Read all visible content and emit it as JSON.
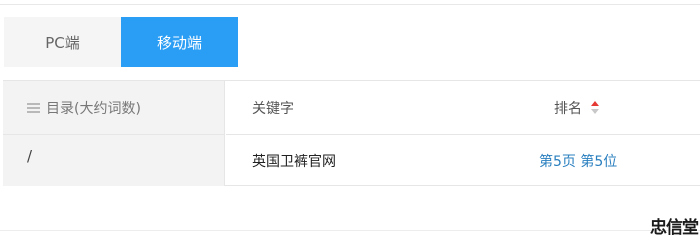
{
  "tabs": [
    {
      "label": "PC端",
      "active": false
    },
    {
      "label": "移动端",
      "active": true
    }
  ],
  "sidebar": {
    "header_label": "目录(大约词数)",
    "items": [
      "/"
    ]
  },
  "table": {
    "columns": {
      "keyword": "关键字",
      "rank": "排名"
    },
    "rows": [
      {
        "keyword": "英国卫裤官网",
        "rank": "第5页 第5位"
      }
    ]
  },
  "colors": {
    "active_tab": "#2a9df4",
    "rank_link": "#2a7fbf",
    "sort_active": "#e53935"
  },
  "watermark": "忠信堂"
}
